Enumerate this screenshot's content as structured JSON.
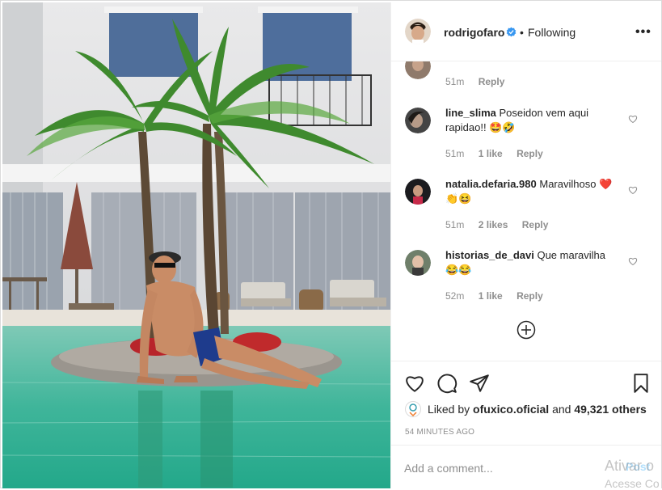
{
  "post": {
    "username": "rodrigofaro",
    "separator": "•",
    "follow_status": "Following",
    "more_label": "•••"
  },
  "comments": [
    {
      "username": "",
      "text": "",
      "time": "51m",
      "likes": "",
      "reply": "Reply"
    },
    {
      "username": "line_slima",
      "text": "Poseidon vem aqui rapidao!! 🤩🤣",
      "time": "51m",
      "likes": "1 like",
      "reply": "Reply"
    },
    {
      "username": "natalia.defaria.980",
      "text": "Maravilhoso ❤️👏😆",
      "time": "51m",
      "likes": "2 likes",
      "reply": "Reply"
    },
    {
      "username": "historias_de_davi",
      "text": "Que maravilha 😂😂",
      "time": "52m",
      "likes": "1 like",
      "reply": "Reply"
    }
  ],
  "likes": {
    "prefix": "Liked by",
    "user": "ofuxico.oficial",
    "middle": "and",
    "count": "49,321 others"
  },
  "time_ago": "54 MINUTES AGO",
  "add_comment": {
    "placeholder": "Add a comment...",
    "post_label": "Post"
  },
  "watermark": {
    "line1": "Ativar o",
    "line2": "Acesse Co"
  }
}
